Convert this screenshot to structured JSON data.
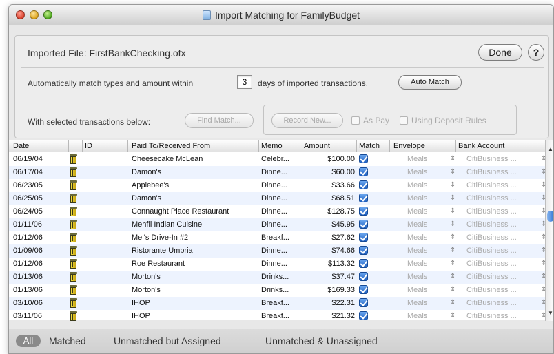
{
  "window": {
    "title": "Import Matching for FamilyBudget"
  },
  "header": {
    "imported_file_label": "Imported File:",
    "imported_file_name": "FirstBankChecking.ofx",
    "done_label": "Done",
    "help_label": "?"
  },
  "auto_match": {
    "text_before": "Automatically match types and amount within",
    "days_value": "3",
    "text_after": "days of imported transactions.",
    "button_label": "Auto Match"
  },
  "selection": {
    "label": "With selected transactions below:",
    "find_match_label": "Find Match...",
    "record_new_label": "Record New...",
    "as_pay_label": "As Pay",
    "using_deposit_rules_label": "Using Deposit Rules"
  },
  "table": {
    "columns": [
      "Date",
      "ID",
      "Paid To/Received From",
      "Memo",
      "Amount",
      "Match",
      "Envelope",
      "Bank Account"
    ],
    "rows": [
      {
        "date": "06/19/04",
        "paid_to": "Cheesecake McLean",
        "memo": "Celebr...",
        "amount": "$100.00",
        "envelope": "Meals",
        "bank": "CitiBusiness ..."
      },
      {
        "date": "06/17/04",
        "paid_to": "Damon's",
        "memo": "Dinne...",
        "amount": "$60.00",
        "envelope": "Meals",
        "bank": "CitiBusiness ..."
      },
      {
        "date": "06/23/05",
        "paid_to": "Applebee's",
        "memo": "Dinne...",
        "amount": "$33.66",
        "envelope": "Meals",
        "bank": "CitiBusiness ..."
      },
      {
        "date": "06/25/05",
        "paid_to": "Damon's",
        "memo": "Dinne...",
        "amount": "$68.51",
        "envelope": "Meals",
        "bank": "CitiBusiness ..."
      },
      {
        "date": "06/24/05",
        "paid_to": "Connaught Place Restaurant",
        "memo": "Dinne...",
        "amount": "$128.75",
        "envelope": "Meals",
        "bank": "CitiBusiness ..."
      },
      {
        "date": "01/11/06",
        "paid_to": "Mehfil Indian Cuisine",
        "memo": "Dinne...",
        "amount": "$45.95",
        "envelope": "Meals",
        "bank": "CitiBusiness ..."
      },
      {
        "date": "01/12/06",
        "paid_to": "Mel's Drive-In #2",
        "memo": "Breakf...",
        "amount": "$27.62",
        "envelope": "Meals",
        "bank": "CitiBusiness ..."
      },
      {
        "date": "01/09/06",
        "paid_to": "Ristorante Umbria",
        "memo": "Dinne...",
        "amount": "$74.66",
        "envelope": "Meals",
        "bank": "CitiBusiness ..."
      },
      {
        "date": "01/12/06",
        "paid_to": "Roe Restaurant",
        "memo": "Dinne...",
        "amount": "$113.32",
        "envelope": "Meals",
        "bank": "CitiBusiness ..."
      },
      {
        "date": "01/13/06",
        "paid_to": "Morton's",
        "memo": "Drinks...",
        "amount": "$37.47",
        "envelope": "Meals",
        "bank": "CitiBusiness ..."
      },
      {
        "date": "01/13/06",
        "paid_to": "Morton's",
        "memo": "Drinks...",
        "amount": "$169.33",
        "envelope": "Meals",
        "bank": "CitiBusiness ..."
      },
      {
        "date": "03/10/06",
        "paid_to": "IHOP",
        "memo": "Breakf...",
        "amount": "$22.31",
        "envelope": "Meals",
        "bank": "CitiBusiness ..."
      },
      {
        "date": "03/11/06",
        "paid_to": "IHOP",
        "memo": "Breakf...",
        "amount": "$21.32",
        "envelope": "Meals",
        "bank": "CitiBusiness ..."
      }
    ]
  },
  "filters": {
    "all": "All",
    "matched": "Matched",
    "unmatched_assigned": "Unmatched but Assigned",
    "unmatched_unassigned": "Unmatched & Unassigned"
  },
  "icons": {
    "close": "close-icon",
    "minimize": "minimize-icon",
    "zoom": "zoom-icon",
    "row": "bin-icon",
    "match": "checkbox-checked-icon"
  },
  "colors": {
    "row_alt": "#edf3fe",
    "check_blue": "#1d5fc0",
    "filter_selected": "#8a8a8a"
  }
}
